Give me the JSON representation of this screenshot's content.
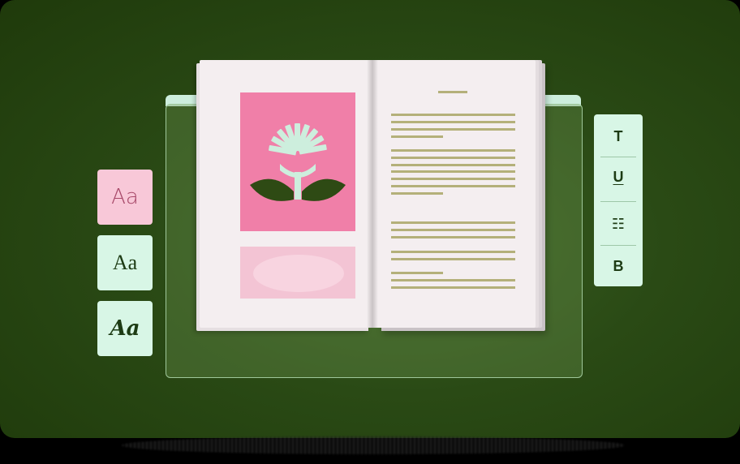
{
  "font_options": [
    {
      "label": "Aa"
    },
    {
      "label": "Aa"
    },
    {
      "label": "Aa"
    }
  ],
  "toolbar": {
    "title_tool": "T",
    "underline_tool": "U",
    "list_tool": "☷",
    "bold_tool": "B"
  },
  "colors": {
    "background": "#1f3a0b",
    "chip_pink": "#f8c8d8",
    "chip_mint": "#d8f6e6",
    "illustration_pink": "#f07fa8",
    "text_lines": "#b4b07a",
    "leaf_green": "#2e4a14"
  },
  "icons": {
    "illustration": "flower-icon",
    "list": "list-icon"
  }
}
